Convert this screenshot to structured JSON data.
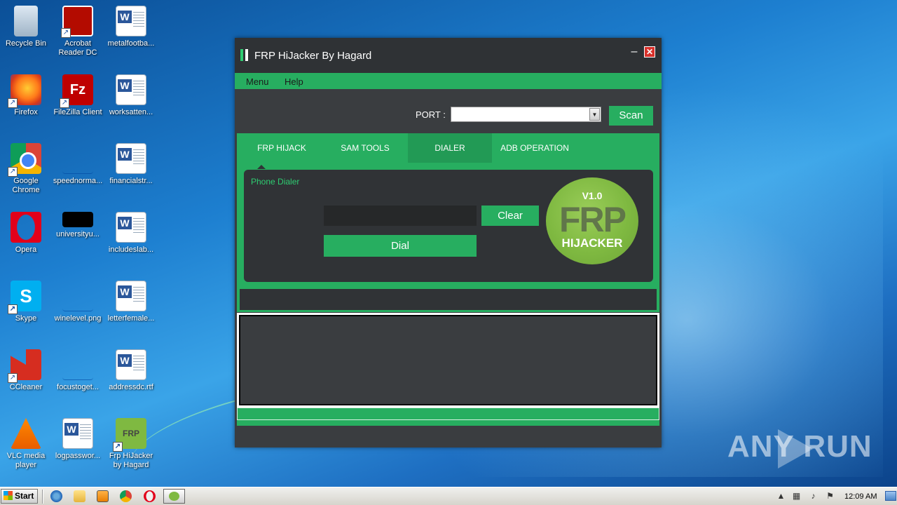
{
  "desktop": {
    "icons": [
      {
        "label": "Recycle Bin"
      },
      {
        "label": "Acrobat Reader DC"
      },
      {
        "label": "metalfootba..."
      },
      {
        "label": "Firefox"
      },
      {
        "label": "FileZilla Client"
      },
      {
        "label": "worksatten..."
      },
      {
        "label": "Google Chrome"
      },
      {
        "label": "speednorma..."
      },
      {
        "label": "financialstr..."
      },
      {
        "label": "Opera"
      },
      {
        "label": "universityu..."
      },
      {
        "label": "includeslab..."
      },
      {
        "label": "Skype"
      },
      {
        "label": "winelevel.png"
      },
      {
        "label": "letterfemale..."
      },
      {
        "label": "CCleaner"
      },
      {
        "label": "focustoget..."
      },
      {
        "label": "addressdc.rtf"
      },
      {
        "label": "VLC media player"
      },
      {
        "label": "logpasswor..."
      },
      {
        "label": "Frp HiJacker by Hagard"
      }
    ],
    "watermark": "ANY RUN"
  },
  "window": {
    "title": "FRP HiJacker By Hagard",
    "minimize_glyph": "–",
    "close_glyph": "✕",
    "menu": [
      {
        "label": "Menu"
      },
      {
        "label": "Help"
      }
    ],
    "port_label": "PORT :",
    "port_value": "",
    "scan_label": "Scan",
    "tabs": [
      {
        "label": "FRP HIJACK",
        "active": false
      },
      {
        "label": "SAM TOOLS",
        "active": false
      },
      {
        "label": "DIALER",
        "active": true
      },
      {
        "label": "ADB OPERATION",
        "active": false
      }
    ],
    "dialer": {
      "panel_label": "Phone Dialer",
      "phone_value": "",
      "clear_label": "Clear",
      "dial_label": "Dial",
      "logo_version": "V1.0",
      "logo_title": "FRP",
      "logo_subtitle": "HIJACKER"
    },
    "log_text": "",
    "colors": {
      "accent": "#27ae60",
      "panel": "#303336",
      "window_bg": "#3a3d40",
      "close": "#d9312b"
    }
  },
  "taskbar": {
    "start_label": "Start",
    "clock": "12:09 AM"
  }
}
